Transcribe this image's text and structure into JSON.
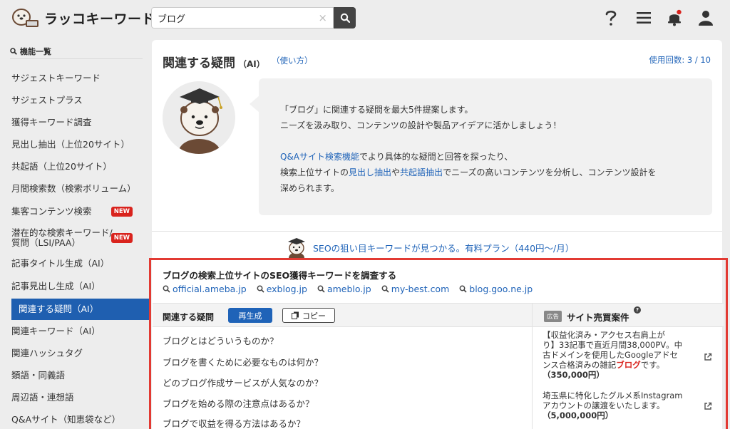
{
  "header": {
    "logo_text": "ラッコキーワード",
    "search_value": "ブログ",
    "clear_glyph": "×"
  },
  "sidebar": {
    "heading": "機能一覧",
    "items": [
      {
        "label": "サジェストキーワード"
      },
      {
        "label": "サジェストプラス"
      },
      {
        "label": "獲得キーワード調査"
      },
      {
        "label": "見出し抽出（上位20サイト）"
      },
      {
        "label": "共起語（上位20サイト）"
      },
      {
        "label": "月間検索数（検索ボリューム）"
      },
      {
        "label": "集客コンテンツ検索",
        "badge": "NEW"
      },
      {
        "label": "潜在的な検索キーワード/",
        "label2": "質問（LSI/PAA）",
        "badge": "NEW"
      },
      {
        "label": "記事タイトル生成（AI）"
      },
      {
        "label": "記事見出し生成（AI）"
      },
      {
        "label": "関連する疑問（AI）",
        "active": true
      },
      {
        "label": "関連キーワード（AI）"
      },
      {
        "label": "関連ハッシュタグ"
      },
      {
        "label": "類語・同義語"
      },
      {
        "label": "周辺語・連想語"
      },
      {
        "label": "Q&Aサイト（知恵袋など）"
      }
    ]
  },
  "main": {
    "title": "関連する疑問",
    "title_suffix": "（AI）",
    "howto": "（使い方）",
    "usage": "使用回数: 3 / 10",
    "intro": {
      "line1": "「ブログ」に関連する疑問を最大5件提案します。",
      "line2": "ニーズを汲み取り、コンテンツの設計や製品アイデアに活かしましょう！",
      "line3_link": "Q&Aサイト検索機能",
      "line3_rest": "でより具体的な疑問と回答を探ったり、",
      "line4_pre": "検索上位サイトの",
      "line4_link1": "見出し抽出",
      "line4_mid": "や",
      "line4_link2": "共起語抽出",
      "line4_post": "でニーズの高いコンテンツを分析し、コンテンツ設計を",
      "line5": "深められます。"
    },
    "promo": "SEOの狙い目キーワードが見つかる。有料プラン（440円〜/月）"
  },
  "seo": {
    "title": "ブログの検索上位サイトのSEO獲得キーワードを調査する",
    "sites": [
      "official.ameba.jp",
      "exblog.jp",
      "ameblo.jp",
      "my-best.com",
      "blog.goo.ne.jp"
    ]
  },
  "questions": {
    "label": "関連する疑問",
    "regenerate": "再生成",
    "copy": "コピー",
    "items": [
      "ブログとはどういうものか？",
      "ブログを書くために必要なものは何か？",
      "どのブログ作成サービスが人気なのか？",
      "ブログを始める際の注意点はあるか？",
      "ブログで収益を得る方法はあるか？"
    ]
  },
  "ads": {
    "badge": "広告",
    "title": "サイト売買案件",
    "help": "?",
    "items": [
      {
        "lines": [
          "【収益化済み・アクセス右肩上が",
          "り】33記事で直近月間38,000PV。中",
          "古ドメインを使用したGoogleアドセ"
        ],
        "line4_pre": "ンス合格済みの雑記",
        "line4_hl": "ブログ",
        "line4_post": "です。",
        "price": "（350,000円）"
      },
      {
        "lines": [
          "埼玉県に特化したグルメ系Instagram",
          "アカウントの譲渡をいたします。"
        ],
        "price": "（5,000,000円）"
      }
    ]
  },
  "colors": {
    "accent": "#1f63b8",
    "highlight_border": "#e23a33",
    "badge_red": "#d9231d"
  }
}
